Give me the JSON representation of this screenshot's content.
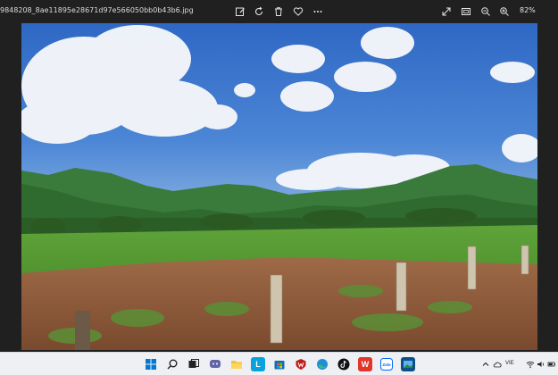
{
  "window": {
    "filename": "9848208_8ae11895e28671d97e566050bb0b43b6.jpg",
    "zoom_label": "82%"
  },
  "toolbar": {
    "icons": [
      "edit-icon",
      "rotate-icon",
      "delete-icon",
      "favorite-icon",
      "more-icon"
    ],
    "view_icons": [
      "fullscreen-icon",
      "fit-icon",
      "zoom-out-icon",
      "zoom-in-icon"
    ]
  },
  "photo": {
    "alt": "Landscape photo: green mountains under blue sky with clouds, grassy field and red dirt ground with concrete posts"
  },
  "taskbar": {
    "apps": [
      "start",
      "search",
      "task-view",
      "chat",
      "file-explorer",
      "app-l",
      "microsoft-store",
      "mcafee",
      "edge",
      "tiktok",
      "wps-office",
      "zalo",
      "photos"
    ],
    "language": "VIE",
    "accent": "#0078d4"
  }
}
